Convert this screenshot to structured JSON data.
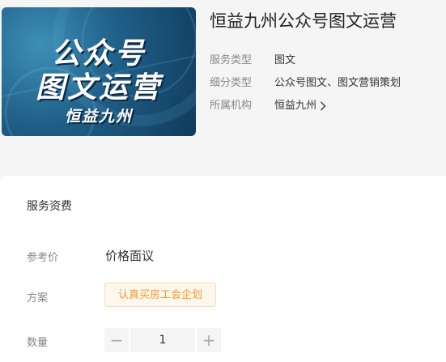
{
  "cover": {
    "line1": "公众号",
    "line2": "图文运营",
    "line3": "恒益九州"
  },
  "title": "恒益九州公众号图文运营",
  "meta": [
    {
      "key": "服务类型",
      "value": "图文"
    },
    {
      "key": "细分类型",
      "value": "公众号图文、图文营销策划"
    },
    {
      "key": "所属机构",
      "value": "恒益九州"
    }
  ],
  "pricing": {
    "section_title": "服务资费",
    "price_label": "参考价",
    "price_value": "价格面议",
    "plan_label": "方案",
    "plan_option": "认真买房工会企划",
    "quantity_label": "数量",
    "quantity_value": "1",
    "minus_symbol": "−",
    "plus_symbol": "+"
  },
  "colors": {
    "accent": "#f39a2a",
    "cover_bg": "#1f5e86"
  },
  "icons": {
    "chevron": "chevron-right-icon"
  }
}
